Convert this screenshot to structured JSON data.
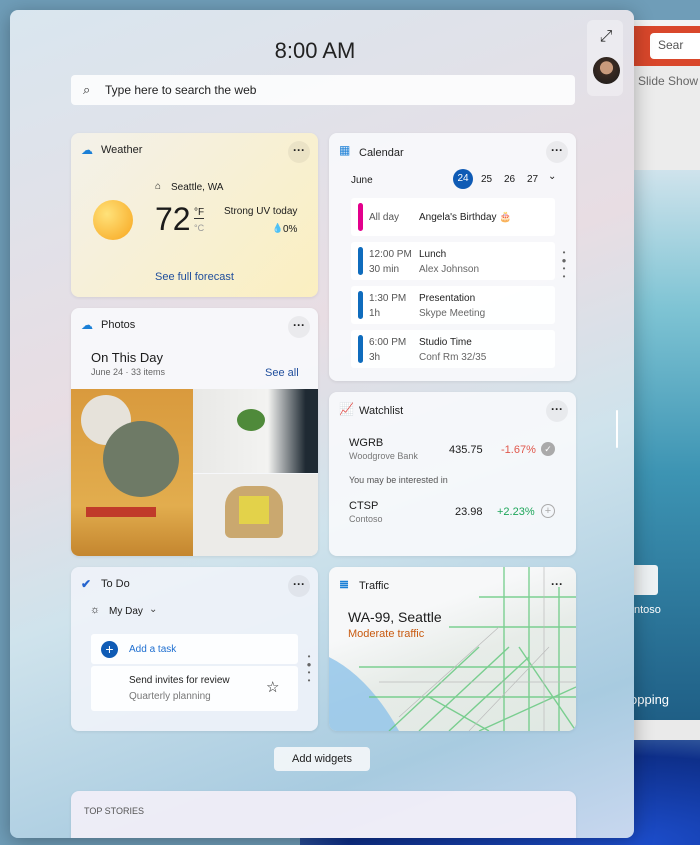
{
  "background_app": {
    "search_label": "Sear",
    "ribbon_tab": "Slide Show",
    "tile_label": "ntoso",
    "shopping_label": "opping"
  },
  "clock": "8:00 AM",
  "search": {
    "placeholder": "Type here to search the web"
  },
  "weather": {
    "title": "Weather",
    "location": "Seattle, WA",
    "temperature": "72",
    "unit_f": "°F",
    "unit_c": "°C",
    "condition": "Strong UV today",
    "precipitation": "0%",
    "link": "See full forecast"
  },
  "photos": {
    "title": "Photos",
    "heading": "On This Day",
    "subheading": "June 24 · 33 items",
    "see_all": "See all"
  },
  "todo": {
    "title": "To Do",
    "list": "My Day",
    "add_task": "Add a task",
    "task": {
      "title": "Send invites for review",
      "subtitle": "Quarterly planning"
    }
  },
  "calendar": {
    "title": "Calendar",
    "month": "June",
    "days": [
      "24",
      "25",
      "26",
      "27"
    ],
    "selected_day": "24",
    "events": [
      {
        "time": "All day",
        "duration": "",
        "title": "Angela's Birthday 🎂",
        "detail": "",
        "color": "#e3008c"
      },
      {
        "time": "12:00 PM",
        "duration": "30 min",
        "title": "Lunch",
        "detail": "Alex Johnson",
        "color": "#0f6cbd"
      },
      {
        "time": "1:30 PM",
        "duration": "1h",
        "title": "Presentation",
        "detail": "Skype Meeting",
        "color": "#0f6cbd"
      },
      {
        "time": "6:00 PM",
        "duration": "3h",
        "title": "Studio Time",
        "detail": "Conf Rm 32/35",
        "color": "#0f6cbd"
      }
    ]
  },
  "watchlist": {
    "title": "Watchlist",
    "stocks": [
      {
        "symbol": "WGRB",
        "name": "Woodgrove Bank",
        "price": "435.75",
        "change": "-1.67%"
      }
    ],
    "suggest_label": "You may be interested in",
    "suggestions": [
      {
        "symbol": "CTSP",
        "name": "Contoso",
        "price": "23.98",
        "change": "+2.23%"
      }
    ],
    "colors": {
      "down": "#e0584c",
      "up": "#1ea65a"
    }
  },
  "traffic": {
    "title": "Traffic",
    "road": "WA-99, Seattle",
    "status": "Moderate traffic",
    "status_color": "#c85a10"
  },
  "add_widgets": "Add widgets",
  "top_stories": "TOP STORIES"
}
